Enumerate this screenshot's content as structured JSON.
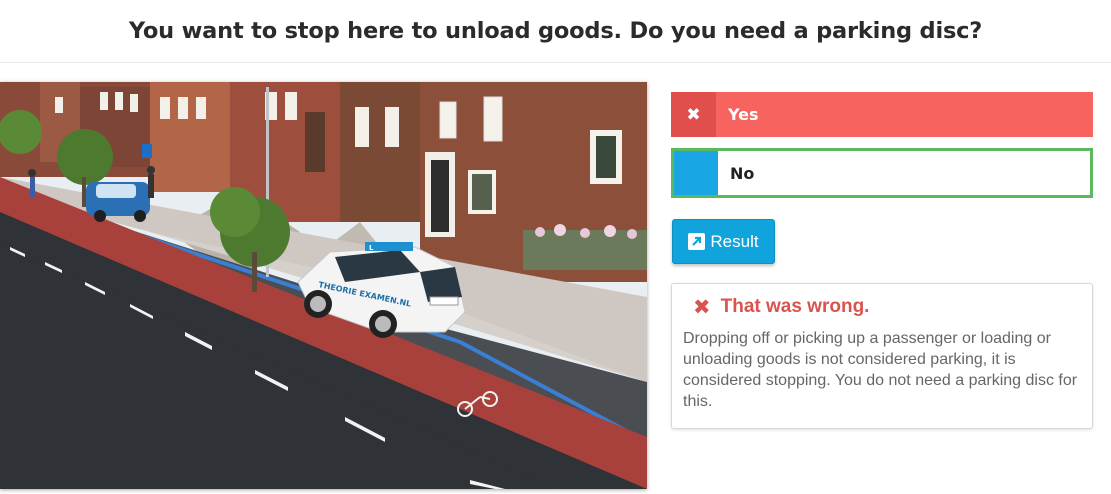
{
  "question": "You want to stop here to unload goods. Do you need a parking disc?",
  "scene": {
    "car_text": "THEORIE EXAMEN.NL",
    "roof_sign": "L"
  },
  "answers": [
    {
      "label": "Yes",
      "icon": "cross-icon",
      "state": "wrong-selected",
      "color": "#f7635f"
    },
    {
      "label": "No",
      "icon": "",
      "state": "correct",
      "color": "#5cb85c"
    }
  ],
  "result_button": {
    "label": "Result",
    "icon": "external-link-icon",
    "color": "#11a3dc"
  },
  "feedback": {
    "icon": "cross-icon",
    "title": "That was wrong.",
    "text": "Dropping off or picking up a passenger or loading or unloading goods is not considered parking, it is considered stopping. You do not need a parking disc for this.",
    "color": "#d9534f"
  }
}
